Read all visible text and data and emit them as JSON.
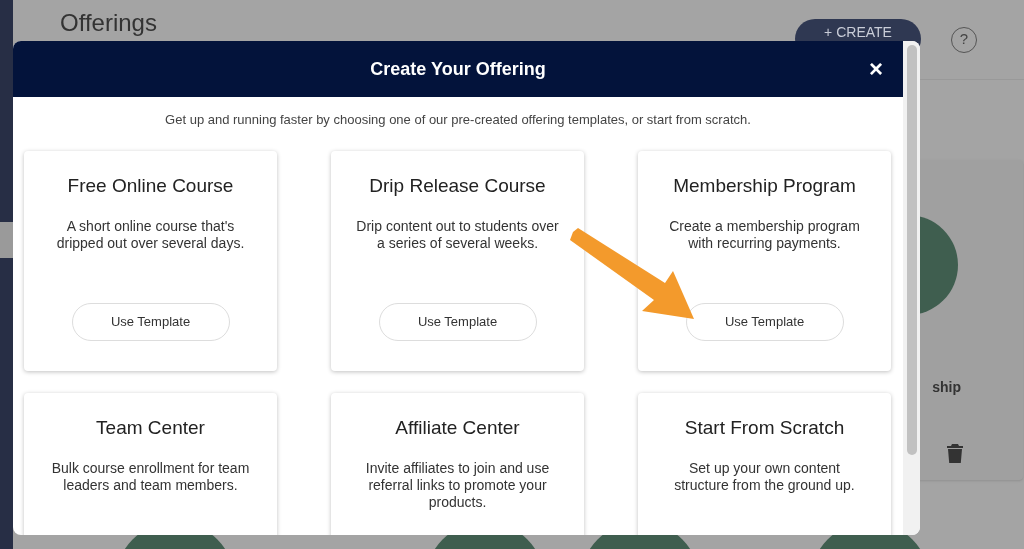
{
  "page": {
    "title": "Offerings",
    "create_button": "+ CREATE",
    "help_button": "?",
    "background_card_text": "ship"
  },
  "modal": {
    "title": "Create Your Offering",
    "close": "×",
    "subtitle": "Get up and running faster by choosing one of our pre-created offering templates, or start from scratch.",
    "templates": [
      {
        "title": "Free Online Course",
        "description": "A short online course that's dripped out over several days.",
        "button": "Use Template"
      },
      {
        "title": "Drip Release Course",
        "description": "Drip content out to students over a series of several weeks.",
        "button": "Use Template"
      },
      {
        "title": "Membership Program",
        "description": "Create a membership program with recurring payments.",
        "button": "Use Template"
      },
      {
        "title": "Team Center",
        "description": "Bulk course enrollment for team leaders and team members."
      },
      {
        "title": "Affiliate Center",
        "description": "Invite affiliates to join and use referral links to promote your products."
      },
      {
        "title": "Start From Scratch",
        "description": "Set up your own content structure from the ground up."
      }
    ]
  }
}
